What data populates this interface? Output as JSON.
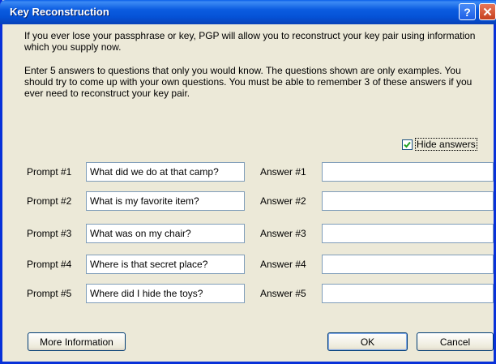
{
  "window": {
    "title": "Key Reconstruction",
    "help_glyph": "?",
    "close_glyph": "✕"
  },
  "intro": {
    "paragraph1": "If you ever lose your passphrase or key, PGP will allow you to reconstruct your key pair using information which you supply now.",
    "paragraph2": "Enter 5 answers to questions that only you would know. The questions shown are only examples.  You should try to come up with your own questions.  You must be able to remember 3 of these answers if you ever need to reconstruct your key pair."
  },
  "hide_answers": {
    "label": "Hide answers",
    "checked": true
  },
  "rows": [
    {
      "prompt_label": "Prompt #1",
      "prompt_value": "What did we do at that camp?",
      "answer_label": "Answer #1",
      "answer_value": ""
    },
    {
      "prompt_label": "Prompt #2",
      "prompt_value": "What is my favorite item?",
      "answer_label": "Answer #2",
      "answer_value": ""
    },
    {
      "prompt_label": "Prompt #3",
      "prompt_value": "What was on my chair?",
      "answer_label": "Answer #3",
      "answer_value": ""
    },
    {
      "prompt_label": "Prompt #4",
      "prompt_value": "Where is that secret place?",
      "answer_label": "Answer #4",
      "answer_value": ""
    },
    {
      "prompt_label": "Prompt #5",
      "prompt_value": "Where did I hide the toys?",
      "answer_label": "Answer #5",
      "answer_value": ""
    }
  ],
  "buttons": {
    "more_info": "More Information",
    "ok": "OK",
    "cancel": "Cancel"
  },
  "colors": {
    "titlebar": "#0a5fe8",
    "dialog_bg": "#ece9d8",
    "checkmark": "#21a121"
  }
}
